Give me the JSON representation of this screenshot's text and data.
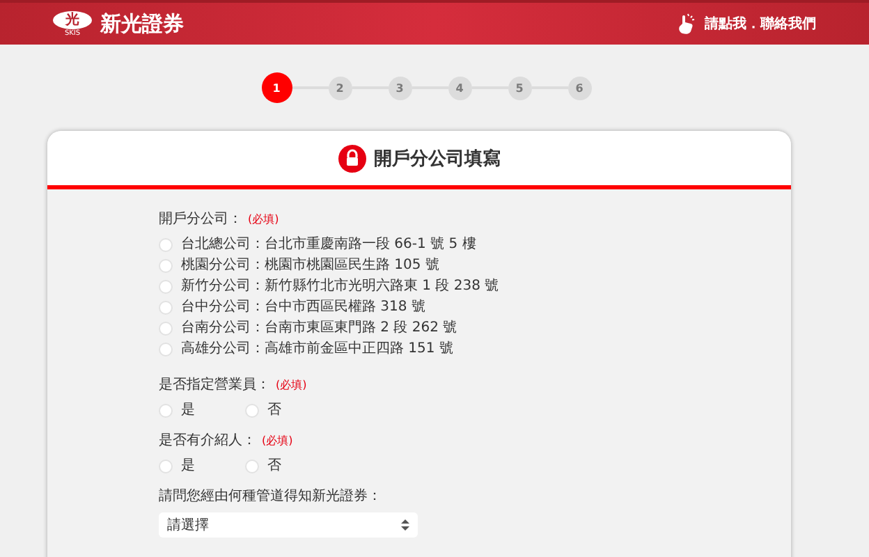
{
  "header": {
    "logo_mark": "光",
    "logo_sub": "SKIS",
    "brand": "新光證券",
    "contact": "請點我．聯絡我們"
  },
  "steps": [
    {
      "label": "1",
      "selected": true
    },
    {
      "label": "2",
      "selected": false
    },
    {
      "label": "3",
      "selected": false
    },
    {
      "label": "4",
      "selected": false
    },
    {
      "label": "5",
      "selected": false
    },
    {
      "label": "6",
      "selected": false
    }
  ],
  "card": {
    "title": "開戶分公司填寫",
    "questions": [
      {
        "kind": "list",
        "label": "開戶分公司：",
        "required": "(必填)",
        "options": [
          {
            "label": "台北總公司：台北市重慶南路一段 66-1 號 5 樓",
            "selected": false
          },
          {
            "label": "桃園分公司：桃園市桃園區民生路 105 號",
            "selected": false
          },
          {
            "label": "新竹分公司：新竹縣竹北市光明六路東 1 段 238 號",
            "selected": false
          },
          {
            "label": "台中分公司：台中市西區民權路 318 號",
            "selected": false
          },
          {
            "label": "台南分公司：台南市東區東門路 2 段 262 號",
            "selected": false
          },
          {
            "label": "高雄分公司：高雄市前金區中正四路 151 號",
            "selected": false
          }
        ]
      },
      {
        "kind": "inline",
        "label": "是否指定營業員：",
        "required": "(必填)",
        "options": [
          {
            "label": "是",
            "selected": false
          },
          {
            "label": "否",
            "selected": false
          }
        ]
      },
      {
        "kind": "inline",
        "label": "是否有介紹人：",
        "required": "(必填)",
        "options": [
          {
            "label": "是",
            "selected": false
          },
          {
            "label": "否",
            "selected": false
          }
        ]
      },
      {
        "kind": "select",
        "label": "請問您經由何種管道得知新光證券：",
        "value": "請選擇"
      }
    ]
  }
}
